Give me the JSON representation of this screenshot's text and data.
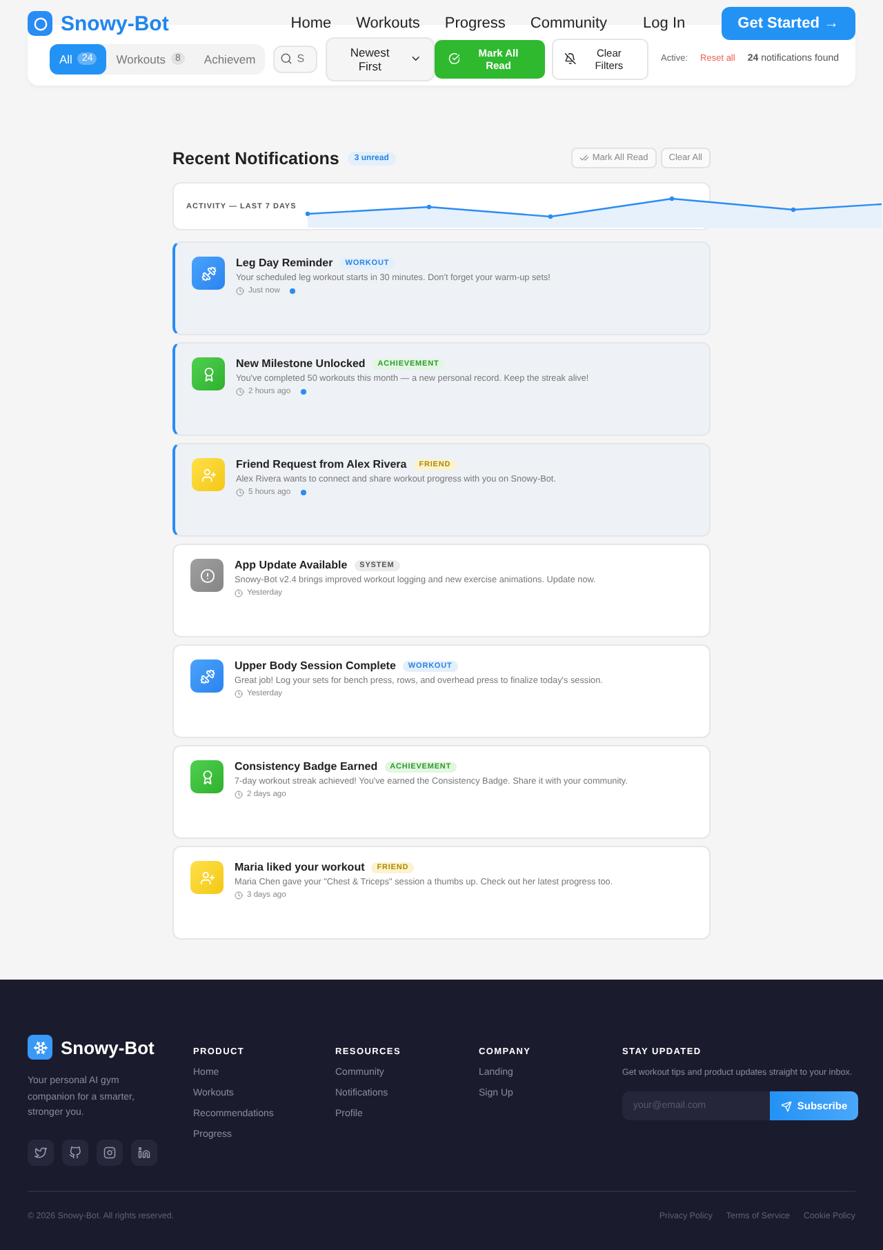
{
  "header": {
    "brand": "Snowy-Bot",
    "nav": [
      "Home",
      "Workouts",
      "Progress",
      "Community"
    ],
    "login": "Log In",
    "cta": "Get Started →"
  },
  "filters": {
    "tabs": [
      {
        "label": "All",
        "count": "24",
        "selected": true
      },
      {
        "label": "Workouts",
        "count": "8",
        "selected": false
      },
      {
        "label": "Achievem",
        "selected": false
      }
    ],
    "search": {
      "placeholder": "S"
    },
    "sort": "Newest First",
    "mark_all": "Mark All Read",
    "clear": "Clear Filters",
    "active_label": "Active:",
    "reset": "Reset all",
    "found": "**24** notifications found"
  },
  "section": {
    "title": "Recent Notifications",
    "unread": "3 unread",
    "mark_all": "Mark All Read",
    "clear_all": "Clear All",
    "activity_label": "ACTIVITY — LAST 7 DAYS"
  },
  "notifications": [
    {
      "kind": "workout",
      "title": "Leg Day Reminder",
      "tag": "WORKOUT",
      "body": "Your scheduled leg workout starts in 30 minutes. Don't forget your warm-up sets!",
      "time": "Just now",
      "unread": true
    },
    {
      "kind": "achievement",
      "title": "New Milestone Unlocked",
      "tag": "ACHIEVEMENT",
      "body": "You've completed 50 workouts this month — a new personal record. Keep the streak alive!",
      "time": "2 hours ago",
      "unread": true
    },
    {
      "kind": "friend",
      "title": "Friend Request from Alex Rivera",
      "tag": "FRIEND",
      "body": "Alex Rivera wants to connect and share workout progress with you on Snowy-Bot.",
      "time": "5 hours ago",
      "unread": true
    },
    {
      "kind": "system",
      "title": "App Update Available",
      "tag": "SYSTEM",
      "body": "Snowy-Bot v2.4 brings improved workout logging and new exercise animations. Update now.",
      "time": "Yesterday",
      "unread": false
    },
    {
      "kind": "workout",
      "title": "Upper Body Session Complete",
      "tag": "WORKOUT",
      "body": "Great job! Log your sets for bench press, rows, and overhead press to finalize today's session.",
      "time": "Yesterday",
      "unread": false
    },
    {
      "kind": "achievement",
      "title": "Consistency Badge Earned",
      "tag": "ACHIEVEMENT",
      "body": "7-day workout streak achieved! You've earned the Consistency Badge. Share it with your community.",
      "time": "2 days ago",
      "unread": false
    },
    {
      "kind": "friend",
      "title": "Maria liked your workout",
      "tag": "FRIEND",
      "body": "Maria Chen gave your \"Chest & Triceps\" session a thumbs up. Check out her latest progress too.",
      "time": "3 days ago",
      "unread": false
    }
  ],
  "footer": {
    "brand": "Snowy-Bot",
    "tagline": "Your personal AI gym companion for a smarter, stronger you.",
    "columns": [
      {
        "heading": "PRODUCT",
        "links": [
          "Home",
          "Workouts",
          "Recommendations",
          "Progress"
        ]
      },
      {
        "heading": "RESOURCES",
        "links": [
          "Community",
          "Notifications",
          "Profile"
        ]
      },
      {
        "heading": "COMPANY",
        "links": [
          "Landing",
          "Sign Up"
        ]
      }
    ],
    "newsletter": {
      "heading": "STAY UPDATED",
      "text": "Get workout tips and product updates straight to your inbox.",
      "placeholder": "your@email.com",
      "button": "Subscribe"
    },
    "copyright": "© 2026 Snowy-Bot. All rights reserved.",
    "legal": [
      "Privacy Policy",
      "Terms of Service",
      "Cookie Policy"
    ]
  }
}
